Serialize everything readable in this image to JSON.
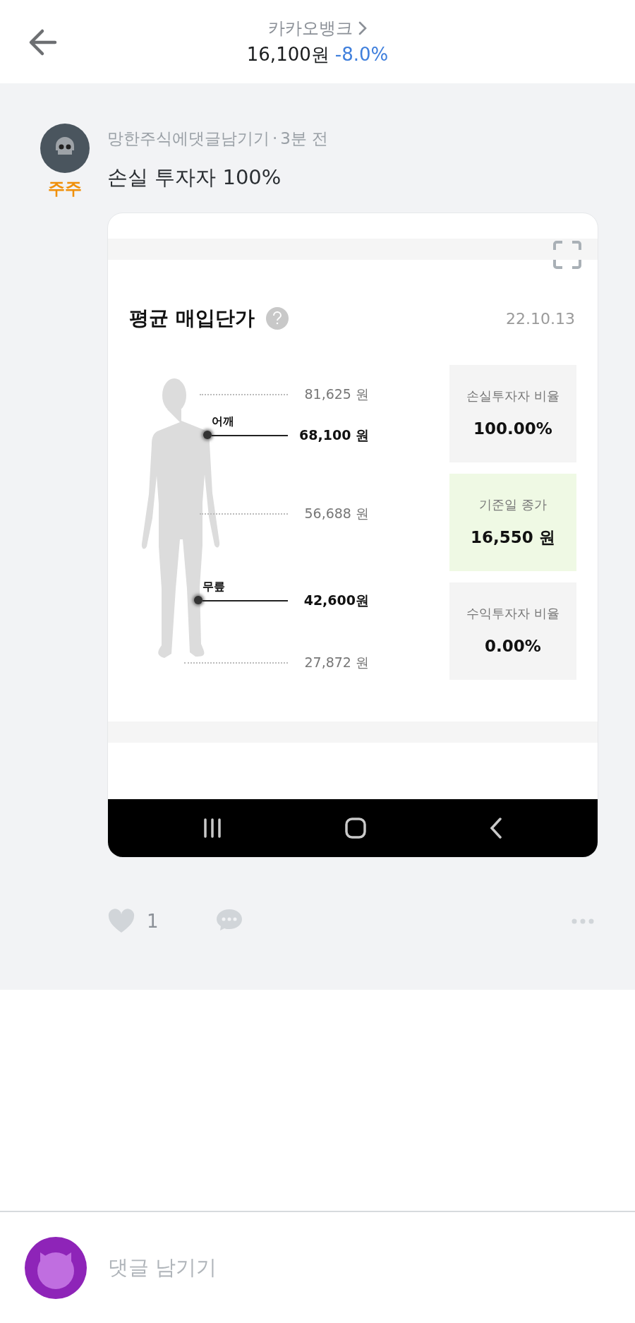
{
  "header": {
    "stock_name": "카카오뱅크",
    "price": "16,100원",
    "change": "-8.0%"
  },
  "post": {
    "author": "망한주식에댓글남기기",
    "separator": "·",
    "time": "3분 전",
    "badge": "주주",
    "text": "손실 투자자 100%",
    "attachment": {
      "title": "평균 매입단가",
      "date": "22.10.13",
      "levels": [
        {
          "kind": "tick",
          "value": "81,625 원"
        },
        {
          "kind": "marker",
          "label": "어깨",
          "value": "68,100 원"
        },
        {
          "kind": "tick",
          "value": "56,688 원"
        },
        {
          "kind": "marker",
          "label": "무릎",
          "value": "42,600원"
        },
        {
          "kind": "tick",
          "value": "27,872 원"
        }
      ],
      "stats": [
        {
          "label": "손실투자자 비율",
          "value": "100.00%",
          "highlighted": false
        },
        {
          "label": "기준일 종가",
          "value": "16,550 원",
          "highlighted": true
        },
        {
          "label": "수익투자자 비율",
          "value": "0.00%",
          "highlighted": false
        }
      ]
    },
    "likes": "1"
  },
  "comment_box": {
    "placeholder": "댓글 남기기"
  }
}
